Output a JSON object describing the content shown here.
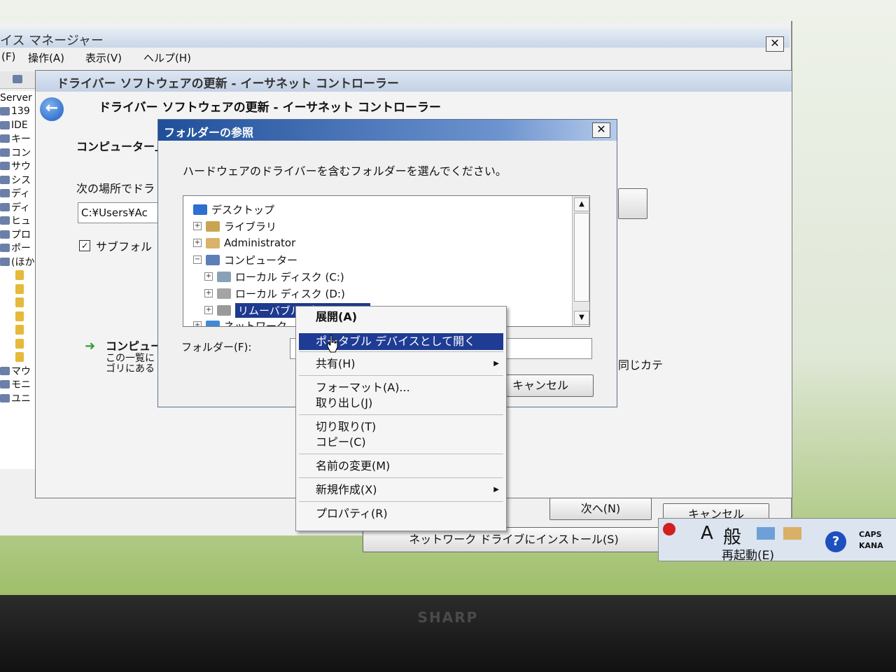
{
  "device_manager": {
    "title": "イス マネージャー",
    "menu": [
      "(F)",
      "操作(A)",
      "表示(V)",
      "ヘルプ(H)"
    ],
    "tree": [
      "Server",
      "139",
      "IDE",
      "キー",
      "コン",
      "サウ",
      "シス",
      "ディ",
      "ディ",
      "ヒュ",
      "プロ",
      "ポー",
      "(ほか",
      "",
      "",
      "",
      "",
      "",
      "",
      "",
      "マウ",
      "モニ",
      "ユニ"
    ]
  },
  "wizard": {
    "window_title": "ドライバー ソフトウェアの更新 - イーサネット コントローラー",
    "header": "ドライバー ソフトウェアの更新 - イーサネット コントローラー",
    "search_heading": "コンピューター上",
    "location_label": "次の場所でドラ",
    "path_value": "C:¥Users¥Ac",
    "include_subfolders": "サブフォル",
    "include_subfolders_checked": "✓",
    "option_title": "コンピュー",
    "option_desc1": "この一覧に",
    "option_desc2": "ゴリにある",
    "same_category": "同じカテ",
    "next_button": "次へ(N)",
    "cancel_button": "キャンセル",
    "network_install_button": "ネットワーク ドライブにインストール(S)",
    "restart_button": "再起動(E)"
  },
  "browse_dialog": {
    "title": "フォルダーの参照",
    "instruction": "ハードウェアのドライバーを含むフォルダーを選んでください。",
    "tree": {
      "desktop": "デスクトップ",
      "libraries": "ライブラリ",
      "administrator": "Administrator",
      "computer": "コンピューター",
      "local_c": "ローカル ディスク (C:)",
      "local_d": "ローカル ディスク (D:)",
      "removable": "リムーバブル ディスク (E:)",
      "network": "ネットワーク"
    },
    "folder_label": "フォルダー(F):",
    "cancel_button": "キャンセル"
  },
  "context_menu": {
    "items": {
      "expand": "展開(A)",
      "open_portable": "ポータブル デバイスとして開く",
      "share": "共有(H)",
      "format": "フォーマット(A)...",
      "eject": "取り出し(J)",
      "cut": "切り取り(T)",
      "copy": "コピー(C)",
      "rename": "名前の変更(M)",
      "new": "新規作成(X)",
      "properties": "プロパティ(R)"
    }
  },
  "language_bar": {
    "ime_mode": "A",
    "ime_general": "般",
    "caps": "CAPS",
    "kana": "KANA"
  },
  "monitor_brand": "SHARP",
  "close_glyph": "✕",
  "expander_plus": "+",
  "expander_minus": "−",
  "scroll_up": "▲",
  "scroll_down": "▼",
  "submenu_glyph": "▶",
  "help_glyph": "?",
  "back_glyph": "←"
}
